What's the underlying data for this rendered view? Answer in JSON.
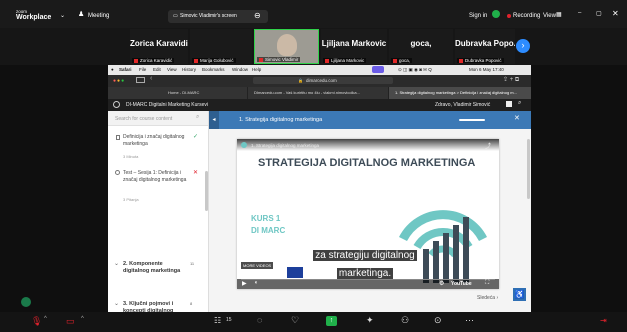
{
  "zoom": {
    "app_title": [
      "zoom",
      "Workplace"
    ],
    "meeting_label": "Meeting",
    "share_label": "Simovic Vladimir's screen",
    "sign_in": "Sign in",
    "recording": "Recording",
    "view": "View"
  },
  "participants": [
    {
      "name": "Zorica Karavidić",
      "sub": "Zorica Karavidić"
    },
    {
      "name": "",
      "sub": "Marija Golubović"
    },
    {
      "name": "",
      "sub": "Simovic Vladimir"
    },
    {
      "name": "Ljiljana Markovic",
      "sub": "Ljiljana Markovic"
    },
    {
      "name": "goca,",
      "sub": "goca,"
    },
    {
      "name": "Dubravka Popo...",
      "sub": "Dubravka Popović"
    }
  ],
  "mac": {
    "menus": [
      "Safari",
      "File",
      "Edit",
      "View",
      "History",
      "Bookmarks",
      "Window",
      "Help"
    ],
    "clock": "Mon 6 May 17:40"
  },
  "browser": {
    "url": "dimarcedu.com",
    "tabs": [
      "Home - DI-MARC",
      "DImarcedu.com - Vaš kurirtitu mo 4lu - vlakmi.nimovicolka...",
      "1. Strategija digitalnog marketinga > Definicija i značaj digitalnog m..."
    ]
  },
  "lms": {
    "course_title": "DI-MARC Digitalni Marketing Kursevi",
    "user": "Zdravo, Vladimir Simović",
    "search_placeholder": "Search for course content",
    "lesson_header": "1. Strategija digitalnog marketinga",
    "next_label": "Sledeća",
    "sidebar": [
      {
        "title": "Definicija i značaj digitalnog marketinga",
        "meta": "3 Minuta",
        "status": "done"
      },
      {
        "title": "Test – Sesija 1: Definicija i značaj digitalnog marketinga",
        "meta": "3 Pitanja",
        "status": "failed"
      }
    ],
    "sections": [
      {
        "title": "2. Komponente digitalnog marketinga",
        "count": "11"
      },
      {
        "title": "3. Ključni pojmovi i koncepti digitalnog marketinga",
        "count": "8"
      }
    ]
  },
  "video": {
    "top_text": "1. Strategija digitalnog marketinga",
    "main_title": "STRATEGIJA DIGITALNOG MARKETINGA",
    "kurs": "KURS 1",
    "sub": "DI MARC",
    "caption_lines": [
      "za strategiju digitalnog",
      "marketinga."
    ],
    "more_videos": "MORE VIDEOS",
    "youtube": "YouTube",
    "brand_color": "#6fc7c4"
  },
  "zoom_bottom": {
    "participants_count": "15"
  },
  "colors": {
    "lesson_header": "#3c79b6",
    "record": "#e0222c",
    "share_green": "#20b04a"
  }
}
